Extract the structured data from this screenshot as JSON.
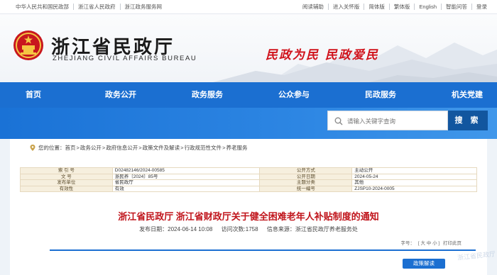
{
  "topbar": {
    "left_links": [
      "中华人民共和国民政部",
      "浙江省人民政府",
      "浙江政务服务网"
    ],
    "right_links": [
      "阅读辅助",
      "进入关怀版",
      "简体版",
      "繁体版",
      "English",
      "智能问答",
      "登录"
    ]
  },
  "header": {
    "title": "浙江省民政厅",
    "subtitle": "ZHEJIANG CIVIL AFFAIRS BUREAU",
    "slogan": "民政为民  民政爱民"
  },
  "nav": {
    "items": [
      "首页",
      "政务公开",
      "政务服务",
      "公众参与",
      "民政服务",
      "机关党建"
    ]
  },
  "search": {
    "placeholder": "请输入关键字查询",
    "button_label": "搜 索"
  },
  "breadcrumb": {
    "label": "您的位置：",
    "items": [
      "首页",
      "政务公开",
      "政府信息公开",
      "政策文件及解读",
      "行政规范性文件",
      "养老服务"
    ],
    "separator": ">"
  },
  "meta": {
    "rows": [
      {
        "k1": "索 引 号",
        "v1": "D02482146/2024-00585",
        "k2": "公开方式",
        "v2": "主动公开"
      },
      {
        "k1": "文    号",
        "v1": "浙民养〔2024〕85号",
        "k2": "公开日期",
        "v2": "2024-05-24"
      },
      {
        "k1": "发布单位",
        "v1": "省民政厅",
        "k2": "主题分类",
        "v2": "其他"
      },
      {
        "k1": "有效性",
        "v1": "有效",
        "k2": "统一编号",
        "v2": "ZJSP10-2024-0005"
      }
    ]
  },
  "doc": {
    "title": "浙江省民政厅 浙江省财政厅关于健全困难老年人补贴制度的通知",
    "publish_date": "发布日期：2024-06-14 10:08",
    "visits": "访问次数:1758",
    "source": "信息来源：浙江省民政厅养老服务处"
  },
  "tools": {
    "font_label": "字号：",
    "font_sizes": "[ 大 中 小 ]",
    "print_label": "打印此页"
  },
  "policy_button": "政策解读",
  "colors": {
    "nav_blue": "#1b6fd1",
    "search_btn": "#12569f",
    "title_red": "#c0141b",
    "slogan_red": "#d0121b",
    "meta_key_bg": "#f6efde"
  }
}
